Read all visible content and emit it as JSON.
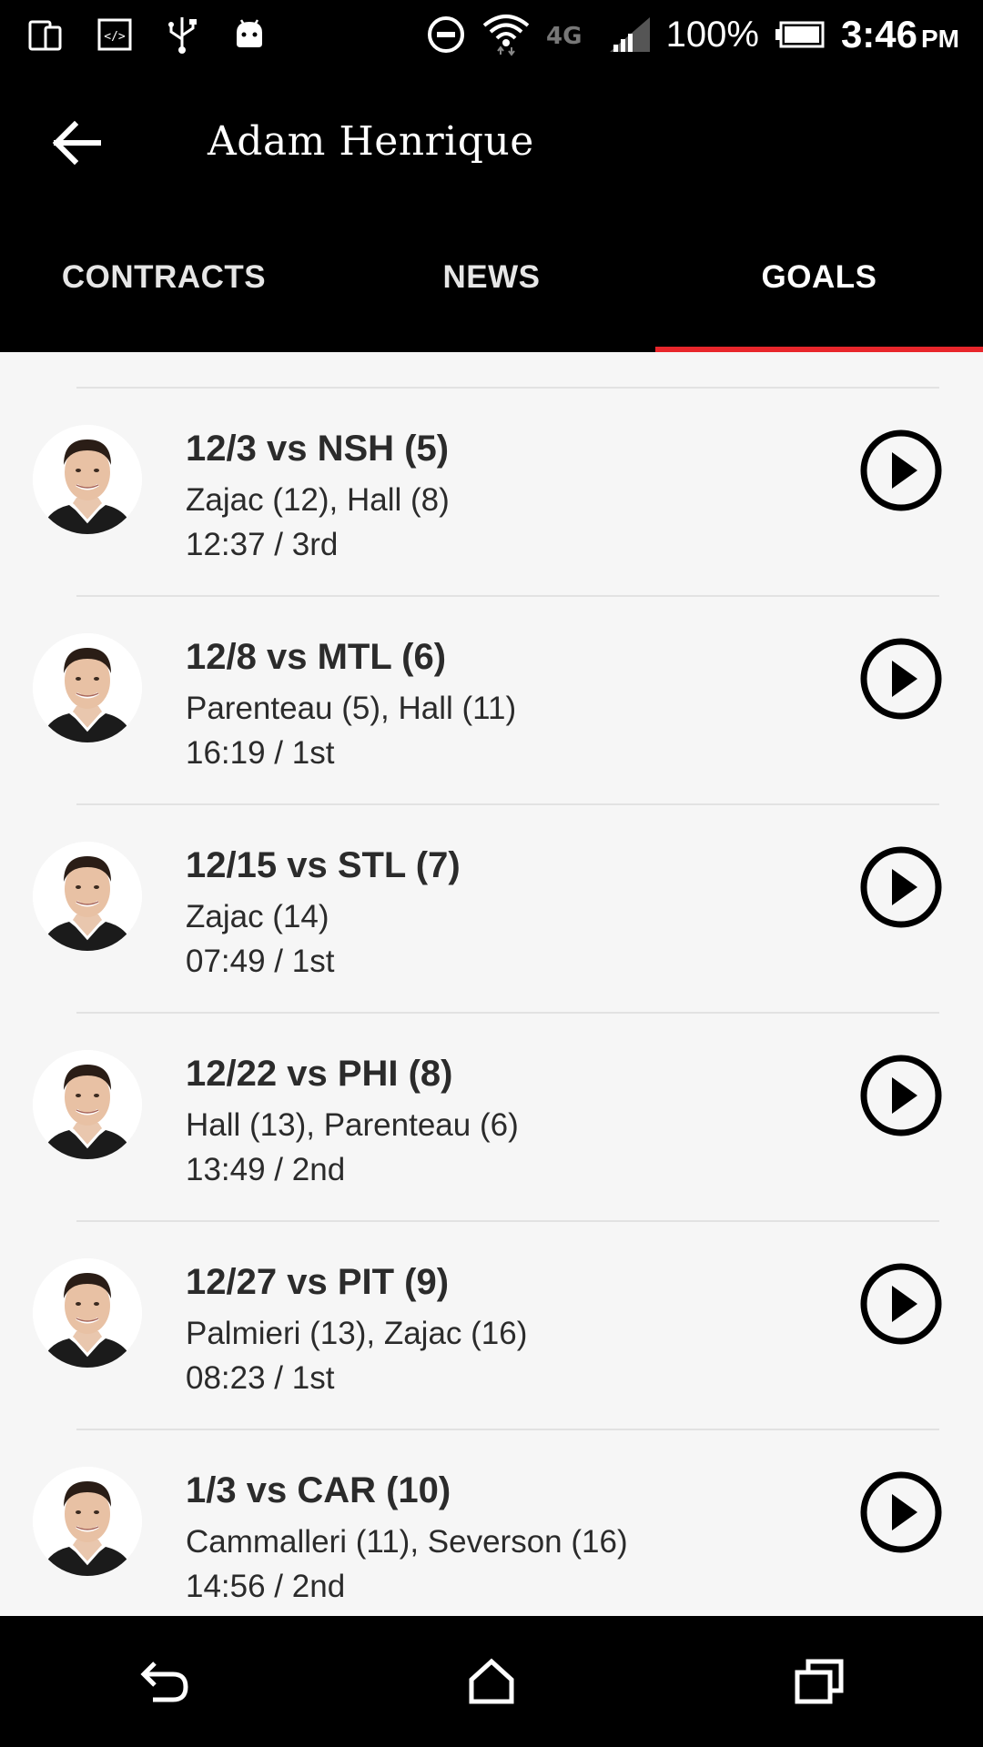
{
  "status_bar": {
    "battery": "100%",
    "time": "3:46",
    "ampm": "PM",
    "network": "4G"
  },
  "app_bar": {
    "title": "Adam Henrique"
  },
  "tabs": [
    {
      "label": "CONTRACTS",
      "active": false
    },
    {
      "label": "NEWS",
      "active": false
    },
    {
      "label": "GOALS",
      "active": true
    }
  ],
  "goals": [
    {
      "title": "12/3 vs NSH (5)",
      "assists": "Zajac (12), Hall (8)",
      "time": "12:37 / 3rd"
    },
    {
      "title": "12/8 vs MTL (6)",
      "assists": "Parenteau (5), Hall (11)",
      "time": "16:19 / 1st"
    },
    {
      "title": "12/15 vs STL (7)",
      "assists": "Zajac (14)",
      "time": "07:49 / 1st"
    },
    {
      "title": "12/22 vs PHI (8)",
      "assists": "Hall (13), Parenteau (6)",
      "time": "13:49 / 2nd"
    },
    {
      "title": "12/27 vs PIT (9)",
      "assists": "Palmieri (13), Zajac (16)",
      "time": "08:23 / 1st"
    },
    {
      "title": "1/3 vs CAR (10)",
      "assists": "Cammalleri (11), Severson (16)",
      "time": "14:56 / 2nd"
    }
  ],
  "colors": {
    "accent": "#e8262b",
    "bar_background": "#000000",
    "list_background": "#f6f6f6"
  },
  "icons": {
    "back": "arrow-left-icon",
    "play": "play-circle-icon",
    "nav_back": "back-icon",
    "nav_home": "home-icon",
    "nav_recents": "recents-icon"
  }
}
